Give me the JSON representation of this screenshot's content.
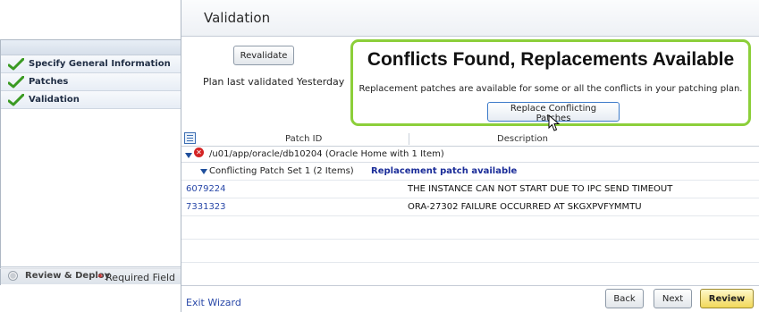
{
  "sidebar": {
    "steps": [
      {
        "label": "Specify General Information",
        "status": "complete"
      },
      {
        "label": "Patches",
        "status": "complete"
      },
      {
        "label": "Validation",
        "status": "complete"
      }
    ],
    "bottom_step": {
      "label": "Review & Deploy",
      "status": "pending"
    },
    "required_mark": "*",
    "required_label": "Required Field"
  },
  "header": {
    "title": "Validation"
  },
  "validation": {
    "revalidate_label": "Revalidate",
    "plan_status": "Plan last validated Yesterday"
  },
  "conflict_panel": {
    "title": "Conflicts Found, Replacements Available",
    "message": "Replacement patches are available for some or all the conflicts in your patching plan.",
    "button_label": "Replace Conflicting Patches",
    "border_color": "#8ccf3a"
  },
  "table": {
    "col_patch_id": "Patch ID",
    "col_description": "Description",
    "home": {
      "path": "/u01/app/oracle/db10204 (Oracle Home with 1 Item)",
      "status_icon": "error-icon"
    },
    "conflict_set": {
      "label": "Conflicting Patch Set 1 (2 Items)",
      "note": "Replacement patch available"
    },
    "patches": [
      {
        "id": "6079224",
        "description": "THE INSTANCE CAN NOT START DUE TO IPC SEND TIMEOUT"
      },
      {
        "id": "7331323",
        "description": "ORA-27302 FAILURE OCCURRED AT SKGXPVFYMMTU"
      }
    ]
  },
  "footer": {
    "exit_label": "Exit Wizard",
    "back_label": "Back",
    "next_label": "Next",
    "review_label": "Review"
  },
  "colors": {
    "accent": "#2948a8",
    "success": "#8ccf3a",
    "error": "#d42424",
    "primary_button": "#f1d85a"
  }
}
